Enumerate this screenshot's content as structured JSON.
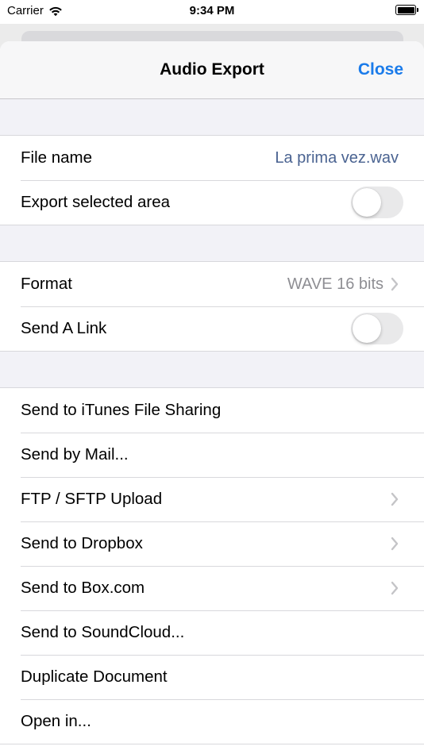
{
  "status_bar": {
    "carrier": "Carrier",
    "time": "9:34 PM",
    "wifi_icon": "wifi-icon",
    "battery_icon": "battery-icon"
  },
  "nav": {
    "title": "Audio Export",
    "close_label": "Close",
    "accent_color": "#1a7bea"
  },
  "section1": {
    "file_name_label": "File name",
    "file_name_value": "La prima vez.wav",
    "export_selected_label": "Export selected area",
    "export_selected_on": false
  },
  "section2": {
    "format_label": "Format",
    "format_value": "WAVE 16 bits",
    "send_link_label": "Send A Link",
    "send_link_on": false
  },
  "section3": {
    "items": [
      {
        "label": "Send to iTunes File Sharing",
        "chevron": false
      },
      {
        "label": "Send by Mail...",
        "chevron": false
      },
      {
        "label": "FTP / SFTP Upload",
        "chevron": true
      },
      {
        "label": "Send to Dropbox",
        "chevron": true
      },
      {
        "label": "Send to Box.com",
        "chevron": true
      },
      {
        "label": "Send to SoundCloud...",
        "chevron": false
      },
      {
        "label": "Duplicate Document",
        "chevron": false
      },
      {
        "label": "Open in...",
        "chevron": false
      }
    ]
  }
}
